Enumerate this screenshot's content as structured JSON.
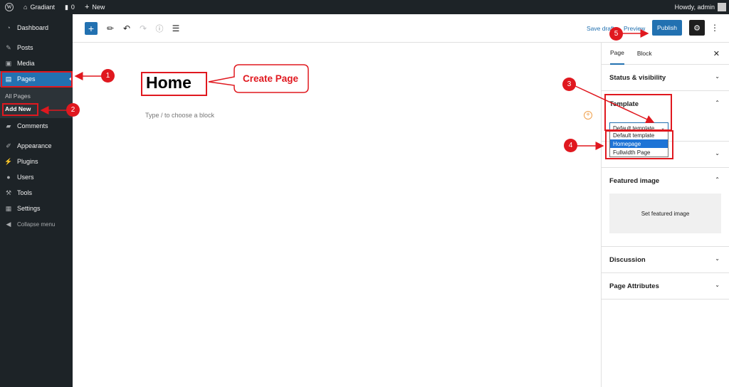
{
  "admin_bar": {
    "site_name": "Gradiant",
    "comments_count": "0",
    "new_label": "New",
    "howdy": "Howdy, admin"
  },
  "sidebar": {
    "items": [
      {
        "label": "Dashboard",
        "icon": "dashboard-icon"
      },
      {
        "label": "Posts",
        "icon": "pin-icon"
      },
      {
        "label": "Media",
        "icon": "media-icon"
      },
      {
        "label": "Pages",
        "icon": "pages-icon"
      },
      {
        "label": "Comments",
        "icon": "comment-icon"
      },
      {
        "label": "Appearance",
        "icon": "brush-icon"
      },
      {
        "label": "Plugins",
        "icon": "plugin-icon"
      },
      {
        "label": "Users",
        "icon": "user-icon"
      },
      {
        "label": "Tools",
        "icon": "wrench-icon"
      },
      {
        "label": "Settings",
        "icon": "settings-icon"
      }
    ],
    "submenu": [
      "All Pages",
      "Add New"
    ],
    "collapse_label": "Collapse menu"
  },
  "toolbar": {
    "save_draft": "Save draft",
    "preview": "Preview",
    "publish": "Publish"
  },
  "editor": {
    "title": "Home",
    "block_placeholder": "Type / to choose a block"
  },
  "panel": {
    "tabs": [
      "Page",
      "Block"
    ],
    "sections": {
      "status": "Status & visibility",
      "template": "Template",
      "featured": "Featured image",
      "discussion": "Discussion",
      "attributes": "Page Attributes"
    },
    "template_value": "Default template",
    "template_options": [
      "Default template",
      "Homepage",
      "Fullwidth Page"
    ],
    "set_featured": "Set featured image"
  },
  "annotations": {
    "callout": "Create Page",
    "steps": [
      "1",
      "2",
      "3",
      "4",
      "5"
    ]
  },
  "colors": {
    "accent": "#2271b1",
    "admin_dark": "#1d2327",
    "annotation_red": "#e0181f"
  }
}
